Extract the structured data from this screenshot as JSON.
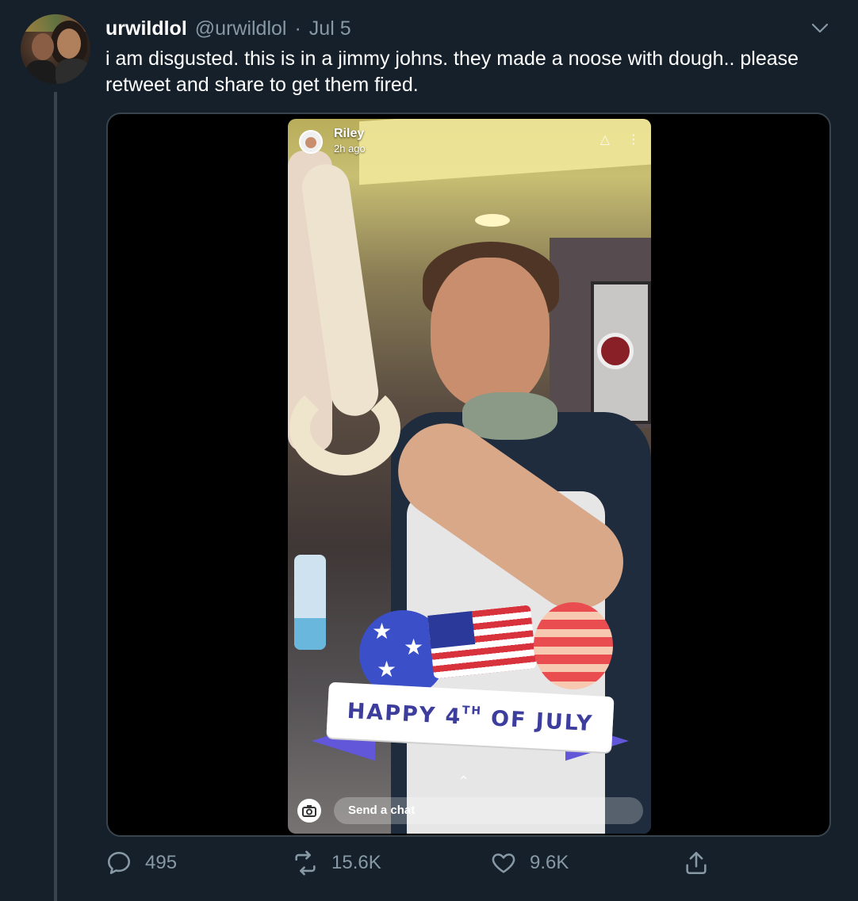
{
  "tweet": {
    "display_name": "urwildlol",
    "handle": "@urwildlol",
    "separator": "·",
    "date": "Jul 5",
    "text": "i am disgusted. this is in a jimmy johns. they made a noose with dough.. please retweet and share to get them fired."
  },
  "media": {
    "snap_username": "Riley",
    "snap_time": "2h ago",
    "sticker_text_main": "HAPPY 4",
    "sticker_text_sup": "TH",
    "sticker_text_end": " OF JULY",
    "chat_placeholder": "Send a chat"
  },
  "actions": {
    "replies": "495",
    "retweets": "15.6K",
    "likes": "9.6K"
  },
  "colors": {
    "background": "#15202b",
    "secondary_text": "#8899a6",
    "border": "#38444d"
  },
  "icons": {
    "reply": "reply-icon",
    "retweet": "retweet-icon",
    "like": "heart-icon",
    "share": "share-icon",
    "caret": "chevron-down-icon"
  }
}
